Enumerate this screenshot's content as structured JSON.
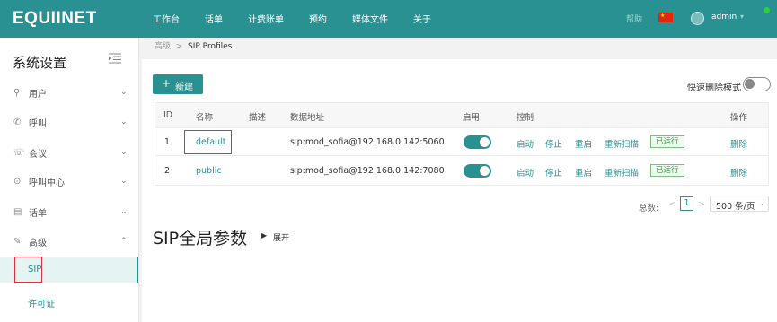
{
  "app": {
    "logo_text": "EQUIINET",
    "nav": [
      "工作台",
      "话单",
      "计费账单",
      "预约",
      "媒体文件",
      "关于"
    ],
    "help": "帮助",
    "user": "admin",
    "colors": {
      "brand": "#2a9192",
      "running_green": "#3a9a41",
      "highlight_red": "#e0303a"
    }
  },
  "sidebar": {
    "title": "系统设置",
    "items": [
      {
        "label": "用户",
        "icon": "user-icon"
      },
      {
        "label": "呼叫",
        "icon": "phone-icon"
      },
      {
        "label": "会议",
        "icon": "conference-icon"
      },
      {
        "label": "呼叫中心",
        "icon": "headset-icon"
      },
      {
        "label": "话单",
        "icon": "cdr-icon"
      },
      {
        "label": "高级",
        "icon": "wrench-icon"
      }
    ],
    "sub_items": [
      {
        "label": "SIP",
        "active": true
      },
      {
        "label": "许可证",
        "active": false
      }
    ]
  },
  "breadcrumb": {
    "parent": "高级",
    "separator": ">",
    "current": "SIP Profiles"
  },
  "toolbar": {
    "new_label": "新建",
    "quick_delete_label": "快速删除模式",
    "quick_delete_on": false
  },
  "table": {
    "headers": {
      "id": "ID",
      "name": "名称",
      "desc": "描述",
      "db_addr": "数据地址",
      "enabled": "启用",
      "control": "控制",
      "actions": "操作"
    },
    "rows": [
      {
        "id": "1",
        "name": "default",
        "desc": "",
        "db_addr": "sip:mod_sofia@192.168.0.142:5060",
        "enabled": true,
        "controls": [
          "启动",
          "停止",
          "重启",
          "重新扫描"
        ],
        "status": "已运行",
        "action": "删除"
      },
      {
        "id": "2",
        "name": "public",
        "desc": "",
        "db_addr": "sip:mod_sofia@192.168.0.142:7080",
        "enabled": true,
        "controls": [
          "启动",
          "停止",
          "重启",
          "重新扫描"
        ],
        "status": "已运行",
        "action": "删除"
      }
    ]
  },
  "pager": {
    "total_label": "总数:",
    "page": "1",
    "page_size": "500 条/页"
  },
  "global": {
    "title": "SIP全局参数",
    "expand_label": "展开"
  }
}
